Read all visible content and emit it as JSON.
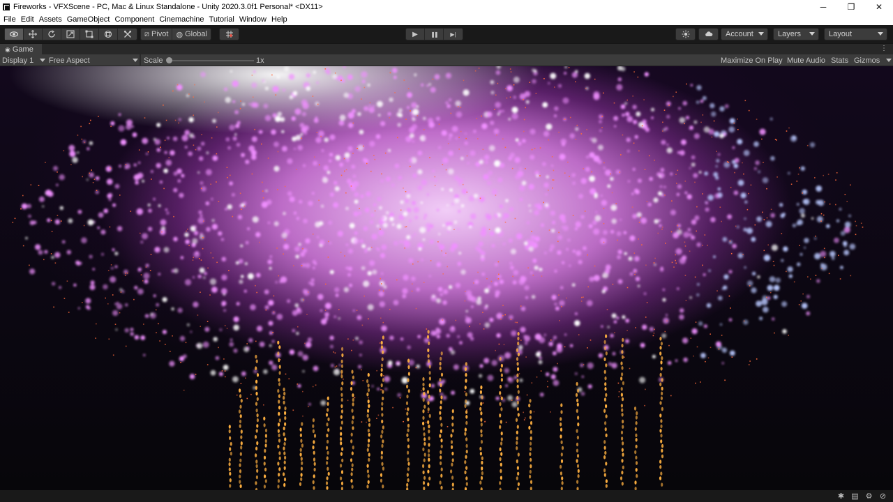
{
  "window": {
    "title": "Fireworks - VFXScene - PC, Mac & Linux Standalone - Unity 2020.3.0f1 Personal* <DX11>",
    "controls": {
      "minimize": "─",
      "restore": "❐",
      "close": "✕"
    }
  },
  "menu": [
    "File",
    "Edit",
    "Assets",
    "GameObject",
    "Component",
    "Cinemachine",
    "Tutorial",
    "Window",
    "Help"
  ],
  "toolbar": {
    "tools": [
      "view-tool-icon",
      "move-tool-icon",
      "rotate-tool-icon",
      "scale-tool-icon",
      "rect-tool-icon",
      "transform-tool-icon",
      "custom-tool-icon"
    ],
    "pivot_label": "Pivot",
    "global_label": "Global",
    "play_icons": {
      "play": "▶",
      "pause": "❚❚",
      "step": "▶|"
    },
    "account_label": "Account",
    "layers_label": "Layers",
    "layout_label": "Layout"
  },
  "game_tab": {
    "label": "Game",
    "menu_icon": "⋮"
  },
  "game_bar": {
    "display": "Display 1",
    "aspect": "Free Aspect",
    "scale_label": "Scale",
    "scale_value": "1x",
    "maximize": "Maximize On Play",
    "mute": "Mute Audio",
    "stats": "Stats",
    "gizmos": "Gizmos"
  },
  "colors": {
    "editor_bg": "#191919",
    "panel": "#3c3c3c",
    "particle_pink": "#f090ff",
    "particle_blue": "#b9c8ff",
    "spark_orange": "#ffb040"
  }
}
